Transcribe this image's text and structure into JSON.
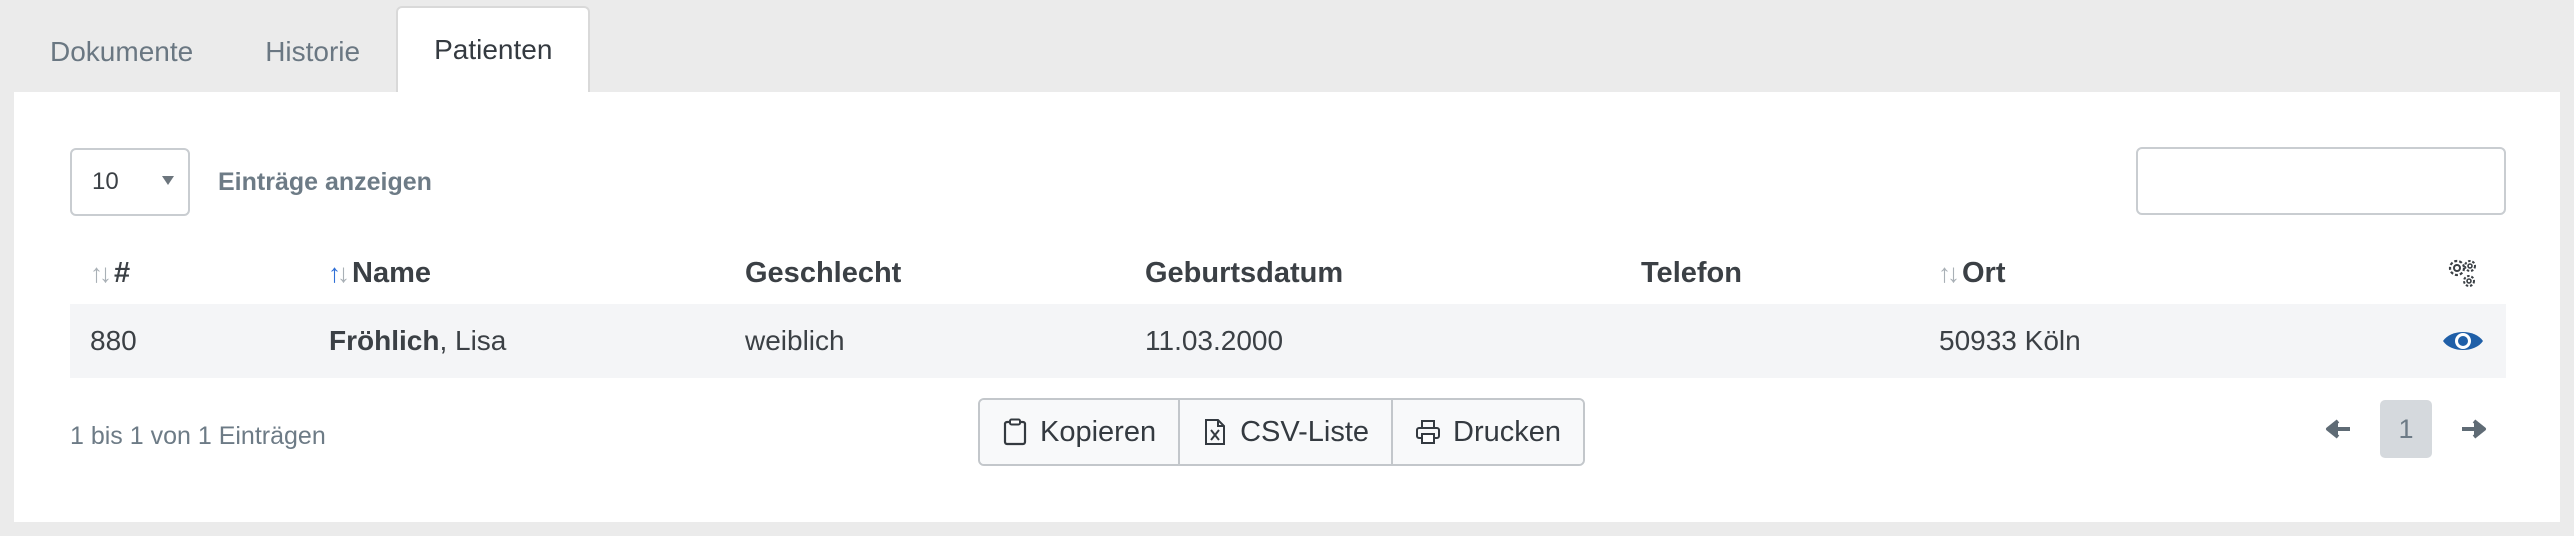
{
  "tabs": [
    {
      "label": "Dokumente",
      "active": false
    },
    {
      "label": "Historie",
      "active": false
    },
    {
      "label": "Patienten",
      "active": true
    }
  ],
  "controls": {
    "length_value": "10",
    "length_label": "Einträge anzeigen",
    "search_value": ""
  },
  "table": {
    "headers": {
      "id": "#",
      "name": "Name",
      "gender": "Geschlecht",
      "birthdate": "Geburtsdatum",
      "phone": "Telefon",
      "city": "Ort"
    },
    "rows": [
      {
        "id": "880",
        "last_name": "Fröhlich",
        "first_name": ", Lisa",
        "gender": "weiblich",
        "birthdate": "11.03.2000",
        "phone": "",
        "city": "50933 Köln"
      }
    ]
  },
  "footer": {
    "info": "1 bis 1 von 1 Einträgen",
    "buttons": {
      "copy": "Kopieren",
      "csv": "CSV-Liste",
      "print": "Drucken"
    },
    "current_page": "1"
  },
  "colors": {
    "sort_active": "#2f6fd6",
    "eye_icon": "#1f5fa8",
    "page_bg": "#ebebeb"
  }
}
